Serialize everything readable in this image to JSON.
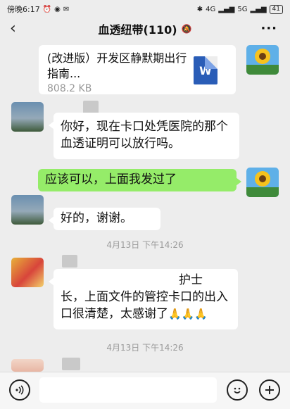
{
  "status_bar": {
    "time": "傍晚6:17",
    "battery": "41",
    "network_1": "4G",
    "network_2": "5G"
  },
  "header": {
    "back_icon": "‹",
    "title": "血透纽带(110)",
    "mute_icon": "🔕",
    "more_icon": "···"
  },
  "messages": {
    "file": {
      "name": "(改进版）开发区静默期出行指南...",
      "size": "808.2 KB",
      "icon_letter": "W"
    },
    "msg1": {
      "text": "你好，现在卡口处凭医院的那个血透证明可以放行吗。"
    },
    "msg2": {
      "text": "应该可以，上面我发过了"
    },
    "msg3": {
      "text": "好的，谢谢。"
    },
    "time1": "4月13日  下午14:26",
    "msg4": {
      "line1": "护士",
      "text": "长，上面文件的管控卡口的出入口很清楚，太感谢了",
      "emoji": "🙏🙏🙏"
    },
    "time2": "4月13日  下午14:26"
  },
  "input_bar": {
    "voice_icon": "voice-icon",
    "emoji_icon": "emoji-icon",
    "plus_icon": "plus-icon"
  }
}
